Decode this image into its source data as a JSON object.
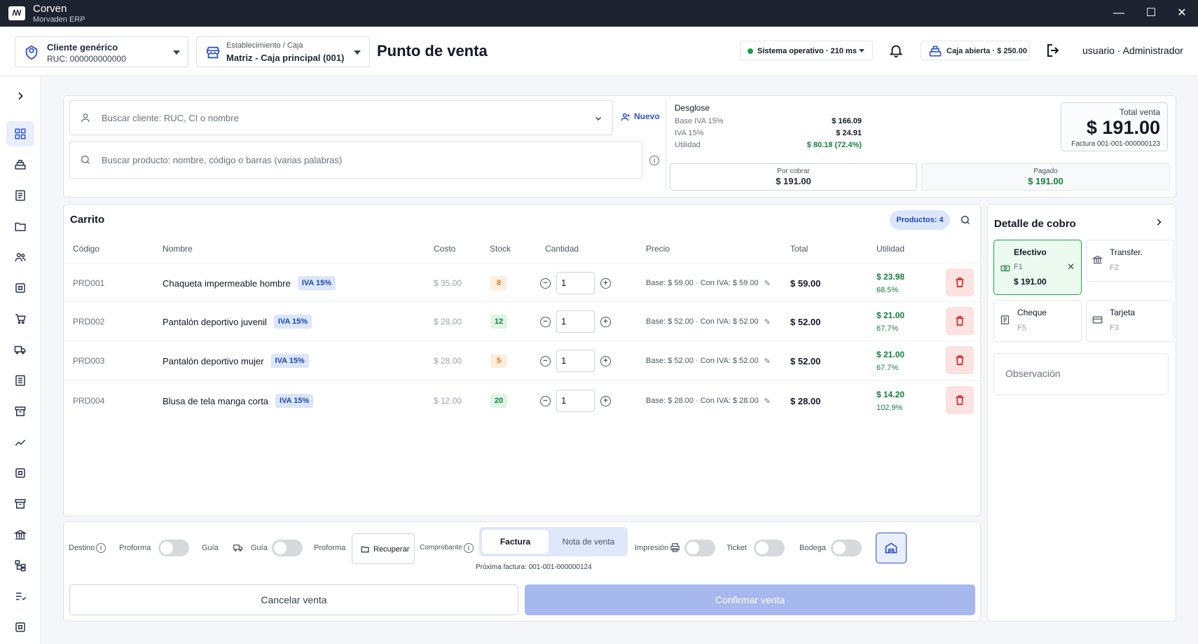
{
  "titlebar": {
    "logo": "ꟿ",
    "app": "Corven",
    "sub": "Morvaden ERP",
    "min": "—",
    "max": "☐",
    "close": "✕"
  },
  "header": {
    "client": {
      "name": "Cliente genérico",
      "ruc": "RUC: 000000000000"
    },
    "estab": {
      "label": "Establecimiento / Caja",
      "value": "Matriz - Caja principal (001)"
    },
    "title": "Punto de venta",
    "status": "Sistema operativo · 210 ms",
    "caja": "Caja abierta · $ 250.00",
    "user": "usuario · Administrador"
  },
  "search": {
    "client_placeholder": "Buscar cliente: RUC, CI o nombre",
    "new_label": "Nuevo",
    "product_placeholder": "Buscar producto: nombre, código o barras (varias palabras)"
  },
  "breakdown": {
    "title": "Desglose",
    "rows": [
      {
        "label": "Base IVA 15%",
        "value": "$ 166.09"
      },
      {
        "label": "IVA 15%",
        "value": "$ 24.91"
      },
      {
        "label": "Utilidad",
        "value": "$ 80.18 (72.4%)"
      }
    ],
    "total_label": "Total venta",
    "total_value": "$ 191.00",
    "invoice": "Factura 001-001-000000123",
    "por_cobrar_label": "Por cobrar",
    "por_cobrar_value": "$ 191.00",
    "pagado_label": "Pagado",
    "pagado_value": "$ 191.00"
  },
  "cart": {
    "title": "Carrito",
    "count_badge": "Productos: 4",
    "headers": [
      "Código",
      "Nombre",
      "Costo",
      "Stock",
      "Cantidad",
      "Precio",
      "Total",
      "Utilidad"
    ],
    "rows": [
      {
        "code": "PRD001",
        "name": "Chaqueta impermeable hombre",
        "tax": "IVA 15%",
        "cost": "$ 35.00",
        "stock": "8",
        "qty": "1",
        "price": "Base: $ 59.00 · Con IVA: $ 59.00",
        "total": "$ 59.00",
        "util": "$ 23.98",
        "util_pct": "68.5%"
      },
      {
        "code": "PRD002",
        "name": "Pantalón deportivo juvenil",
        "tax": "IVA 15%",
        "cost": "$ 28.00",
        "stock": "12",
        "qty": "1",
        "price": "Base: $ 52.00 · Con IVA: $ 52.00",
        "total": "$ 52.00",
        "util": "$ 21.00",
        "util_pct": "67.7%"
      },
      {
        "code": "PRD003",
        "name": "Pantalón deportivo mujer",
        "tax": "IVA 15%",
        "cost": "$ 28.00",
        "stock": "5",
        "qty": "1",
        "price": "Base: $ 52.00 · Con IVA: $ 52.00",
        "total": "$ 52.00",
        "util": "$ 21.00",
        "util_pct": "67.7%"
      },
      {
        "code": "PRD004",
        "name": "Blusa de tela manga corta",
        "tax": "IVA 15%",
        "cost": "$ 12.00",
        "stock": "20",
        "qty": "1",
        "price": "Base: $ 28.00 · Con IVA: $ 28.00",
        "total": "$ 28.00",
        "util": "$ 14.20",
        "util_pct": "102.9%"
      }
    ]
  },
  "options": {
    "destino": "Destino",
    "proforma1": "Proforma",
    "guia1": "Guía",
    "guia2": "Guía",
    "proforma2": "Proforma",
    "recuperar": "Recuperar",
    "comprobante": "Comprobante",
    "factura": "Factura",
    "nota": "Nota de venta",
    "impresion": "Impresión",
    "ticket": "Ticket",
    "bodega": "Bodega",
    "proxima": "Próxima factura: 001-001-000000124"
  },
  "actions": {
    "cancel": "Cancelar venta",
    "confirm": "Confirmar venta"
  },
  "payment": {
    "title": "Detalle de cobro",
    "methods": [
      {
        "name": "Efectivo",
        "key": "F1",
        "value": "$ 191.00"
      },
      {
        "name": "Transfer.",
        "key": "F2"
      },
      {
        "name": "Cheque",
        "key": "F5"
      },
      {
        "name": "Tarjeta",
        "key": "F3"
      }
    ],
    "observacion": "Observación"
  },
  "colors": {
    "accent": "#2f56c5",
    "success": "#16a34a",
    "danger": "#dc2626",
    "titlebar": "#1e2330"
  }
}
